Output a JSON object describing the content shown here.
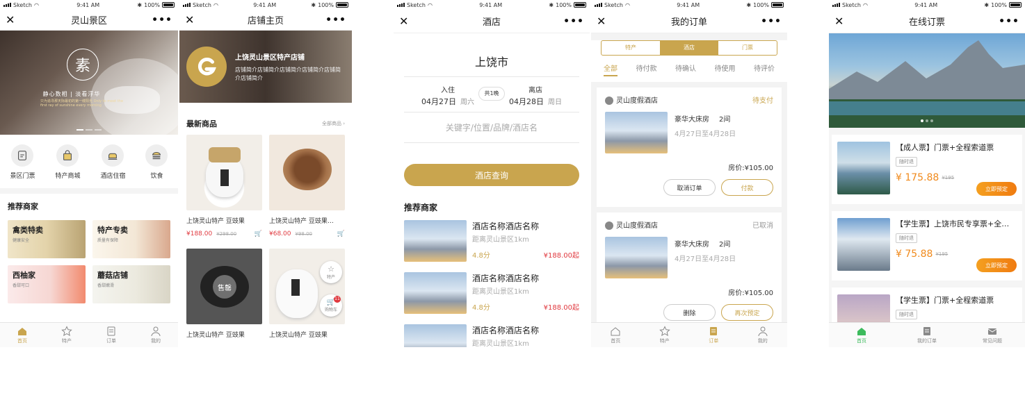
{
  "status": {
    "carrier": "Sketch",
    "time": "9:41 AM",
    "battery": "100%"
  },
  "icons": {
    "close": "close-icon",
    "more": "more-dots-icon",
    "wifi": "wifi-icon",
    "bluetooth": "bluetooth-icon",
    "cart": "cart-icon",
    "star": "star-icon"
  },
  "colors": {
    "accent": "#c9a54e",
    "price_red": "#e0383e",
    "orange": "#f08a1c"
  },
  "screen1": {
    "title": "灵山景区",
    "banner": {
      "char": "素",
      "slogan": "静心数相 | 淡看浮华",
      "sub": "只为追寻那天际最初的第一缕阳光 Only to meet the first ray of sunshine every morning"
    },
    "categories": [
      {
        "label": "景区门票",
        "icon": "ticket-icon"
      },
      {
        "label": "特产商城",
        "icon": "shopping-bag-icon"
      },
      {
        "label": "酒店住宿",
        "icon": "hotel-bed-icon"
      },
      {
        "label": "饮食",
        "icon": "food-burger-icon"
      }
    ],
    "merchants_title": "推荐商家",
    "merchants": [
      {
        "title": "禽类特卖",
        "sub": "健康安全"
      },
      {
        "title": "特产专卖",
        "sub": "质量有保障"
      },
      {
        "title": "西柚家",
        "sub": "香甜可口"
      },
      {
        "title": "蘑菇店铺",
        "sub": "香甜嫩滑"
      }
    ],
    "tabs": [
      "首页",
      "特产",
      "订单",
      "我的"
    ]
  },
  "screen2": {
    "title": "店铺主页",
    "store_name": "上饶灵山景区特产店铺",
    "store_desc": "店铺简介店铺简介店铺简介店铺简介店铺简介店铺简介",
    "section_title": "最新商品",
    "all_link": "全部商品",
    "products": [
      {
        "name": "上饶灵山特产 豆豉果",
        "price": "¥188.00",
        "old": "¥298.00"
      },
      {
        "name": "上饶灵山特产 豆豉果…",
        "price": "¥68.00",
        "old": "¥98.00"
      },
      {
        "name": "上饶灵山特产 豆豉果",
        "badge": "售罄"
      },
      {
        "name": "上饶灵山特产 豆豉果"
      }
    ],
    "float_fav": "特产",
    "float_cart": "购物车",
    "cart_count": "11"
  },
  "screen3": {
    "title": "酒店",
    "city": "上饶市",
    "checkin_label": "入住",
    "checkin_date": "04月27日",
    "checkin_week": "周六",
    "nights": "共1晚",
    "checkout_label": "离店",
    "checkout_date": "04月28日",
    "checkout_week": "周日",
    "keyword_placeholder": "关键字/位置/品牌/酒店名",
    "search_button": "酒店查询",
    "rec_title": "推荐商家",
    "hotels": [
      {
        "name": "酒店名称酒店名称",
        "dist": "距离灵山景区1km",
        "score": "4.8分",
        "price": "¥188.00起"
      },
      {
        "name": "酒店名称酒店名称",
        "dist": "距离灵山景区1km",
        "score": "4.8分",
        "price": "¥188.00起"
      },
      {
        "name": "酒店名称酒店名称",
        "dist": "距离灵山景区1km",
        "score": "",
        "price": ""
      }
    ]
  },
  "screen4": {
    "title": "我的订单",
    "segments": [
      "特产",
      "酒店",
      "门票"
    ],
    "segment_active": 1,
    "order_tabs": [
      "全部",
      "待付款",
      "待确认",
      "待使用",
      "待评价"
    ],
    "orders": [
      {
        "shop": "灵山度假酒店",
        "status": "待支付",
        "room": "豪华大床房",
        "qty": "2间",
        "dates": "4月27日至4月28日",
        "price_label": "房价:",
        "price": "¥105.00",
        "btn1": "取消订单",
        "btn2": "付款"
      },
      {
        "shop": "灵山度假酒店",
        "status": "已取消",
        "room": "豪华大床房",
        "qty": "2间",
        "dates": "4月27日至4月28日",
        "price_label": "房价:",
        "price": "¥105.00",
        "btn1": "删除",
        "btn2": "再次预定"
      }
    ],
    "tabs": [
      "首页",
      "特产",
      "订单",
      "我的"
    ]
  },
  "screen5": {
    "title": "在线订票",
    "tickets": [
      {
        "name": "【成人票】门票+全程索道票",
        "tag": "随时退",
        "price": "¥ 175.88",
        "old": "¥195",
        "btn": "立即预定"
      },
      {
        "name": "【学生票】上饶市民专享票+全…",
        "tag": "随时退",
        "price": "¥ 75.88",
        "old": "¥195",
        "btn": "立即预定"
      },
      {
        "name": "【学生票】门票+全程索道票",
        "tag": "随时退",
        "price": "",
        "old": "",
        "btn": ""
      }
    ],
    "tabs": [
      "首页",
      "我的订单",
      "常见问题"
    ]
  }
}
